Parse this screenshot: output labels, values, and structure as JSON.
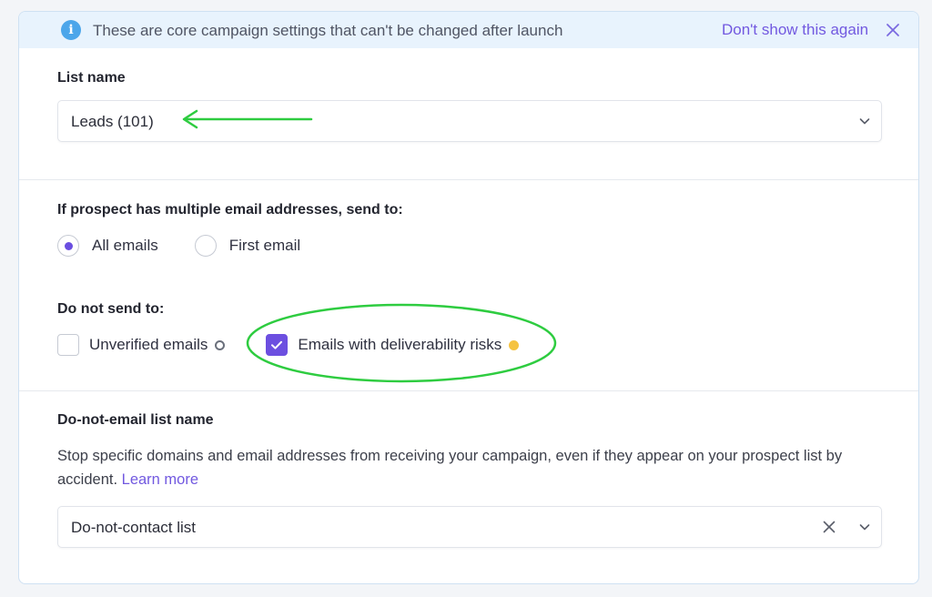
{
  "banner": {
    "icon": "info-icon",
    "message": "These are core campaign settings that can't be changed after launch",
    "dismiss_label": "Don't show this again"
  },
  "list_name": {
    "label": "List name",
    "value": "Leads (101)"
  },
  "multiple_emails": {
    "label": "If prospect has multiple email addresses, send to:",
    "options": [
      {
        "label": "All emails",
        "checked": true
      },
      {
        "label": "First email",
        "checked": false
      }
    ]
  },
  "do_not_send": {
    "label": "Do not send to:",
    "options": [
      {
        "label": "Unverified emails",
        "checked": false
      },
      {
        "label": "Emails with deliverability risks",
        "checked": true
      }
    ]
  },
  "do_not_email": {
    "label": "Do-not-email list name",
    "description": "Stop specific domains and email addresses from receiving your campaign, even if they appear on your prospect list by accident.",
    "learn_more": "Learn more",
    "value": "Do-not-contact list"
  },
  "colors": {
    "accent": "#6c4fe0",
    "link": "#7259e0",
    "banner_bg": "#e8f3fd",
    "annotation": "#2ecc40",
    "risk_dot": "#f5c342"
  }
}
